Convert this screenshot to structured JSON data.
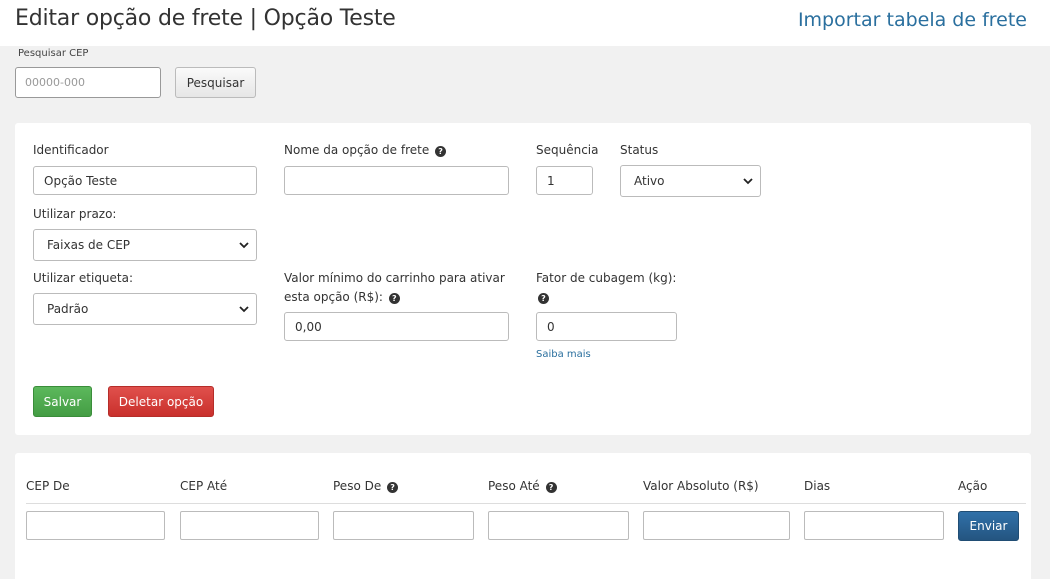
{
  "header": {
    "title": "Editar opção de frete | Opção Teste",
    "import_link": "Importar tabela de frete"
  },
  "search": {
    "label": "Pesquisar CEP",
    "placeholder": "00000-000",
    "button": "Pesquisar"
  },
  "form": {
    "identificador": {
      "label": "Identificador",
      "value": "Opção Teste"
    },
    "nome": {
      "label": "Nome da opção de frete",
      "value": ""
    },
    "sequencia": {
      "label": "Sequência",
      "value": "1"
    },
    "status": {
      "label": "Status",
      "selected": "Ativo"
    },
    "prazo": {
      "label": "Utilizar prazo:",
      "selected": "Faixas de CEP"
    },
    "etiqueta": {
      "label": "Utilizar etiqueta:",
      "selected": "Padrão"
    },
    "valor_minimo": {
      "label_line1": "Valor mínimo do carrinho para ativar",
      "label_line2": "esta opção (R$):",
      "value": "0,00"
    },
    "cubagem": {
      "label": "Fator de cubagem (kg):",
      "value": "0",
      "link": "Saiba mais"
    },
    "save_button": "Salvar",
    "delete_button": "Deletar opção"
  },
  "table": {
    "columns": [
      "CEP De",
      "CEP Até",
      "Peso De",
      "Peso Até",
      "Valor Absoluto (R$)",
      "Dias",
      "Ação"
    ],
    "send_button": "Enviar"
  },
  "icons": {
    "help": "question-circle-icon",
    "chevron": "chevron-down-icon"
  },
  "colors": {
    "link": "#2a6f9e",
    "save": "#5cb85c",
    "delete": "#d9534f",
    "send": "#2e6da4"
  }
}
